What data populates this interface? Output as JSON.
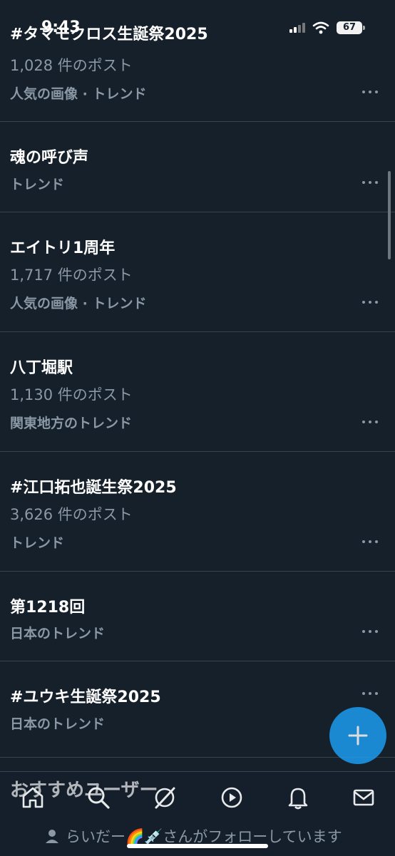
{
  "status_bar": {
    "time": "9:43",
    "battery": "67"
  },
  "trends": [
    {
      "title": "#タマモクロス生誕祭2025",
      "posts": "1,028 件のポスト",
      "meta": "人気の画像 · トレンド"
    },
    {
      "title": "魂の呼び声",
      "posts": "",
      "meta": "トレンド"
    },
    {
      "title": "エイトリ1周年",
      "posts": "1,717 件のポスト",
      "meta": "人気の画像 · トレンド"
    },
    {
      "title": "八丁堀駅",
      "posts": "1,130 件のポスト",
      "meta": "関東地方のトレンド"
    },
    {
      "title": "#江口拓也誕生祭2025",
      "posts": "3,626 件のポスト",
      "meta": "トレンド"
    },
    {
      "title": "第1218回",
      "posts": "",
      "meta": "日本のトレンド"
    },
    {
      "title": "#ユウキ生誕祭2025",
      "posts": "",
      "meta": "日本のトレンド"
    }
  ],
  "section": {
    "title": "おすすめユーザー"
  },
  "follow_line": {
    "text": "らいだー🌈💉さんがフォローしています"
  },
  "tabbar": {
    "icons": [
      "home-icon",
      "search-icon",
      "grok-icon",
      "video-icon",
      "bell-icon",
      "mail-icon"
    ]
  },
  "colors": {
    "background": "#15202b",
    "accent": "#1d9bf0",
    "muted": "#8b98a5",
    "divider": "#38444d"
  }
}
